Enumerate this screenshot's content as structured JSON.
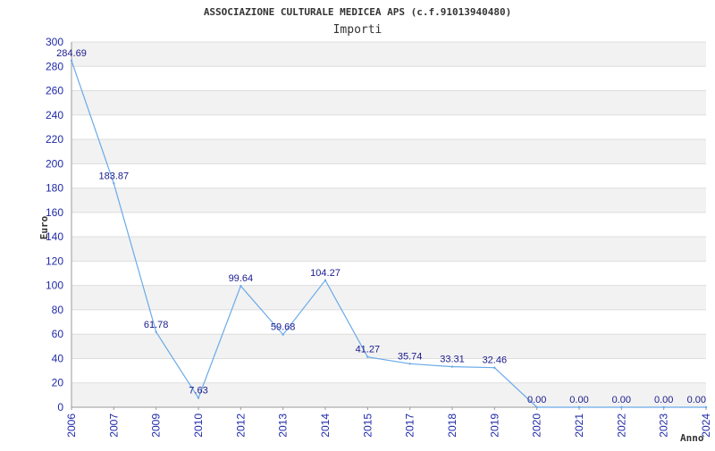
{
  "chart_data": {
    "type": "line",
    "title": "ASSOCIAZIONE CULTURALE MEDICEA APS (c.f.91013940480)",
    "subtitle": "Importi",
    "xlabel": "Anno",
    "ylabel": "Euro",
    "ylim": [
      0,
      300
    ],
    "y_ticks": [
      "0",
      "20",
      "40",
      "60",
      "80",
      "100",
      "120",
      "140",
      "160",
      "180",
      "200",
      "220",
      "240",
      "260",
      "280",
      "300"
    ],
    "categories": [
      "2006",
      "2007",
      "2009",
      "2010",
      "2012",
      "2013",
      "2014",
      "2015",
      "2017",
      "2018",
      "2019",
      "2020",
      "2021",
      "2022",
      "2023",
      "2024"
    ],
    "values": [
      284.69,
      183.87,
      61.78,
      7.63,
      99.64,
      59.68,
      104.27,
      41.27,
      35.74,
      33.31,
      32.46,
      0.0,
      0.0,
      0.0,
      0.0,
      0.0
    ],
    "value_labels": [
      "284.69",
      "183.87",
      "61.78",
      "7.63",
      "99.64",
      "59.68",
      "104.27",
      "41.27",
      "35.74",
      "33.31",
      "32.46",
      "0.00",
      "0.00",
      "0.00",
      "0.00",
      "0.00"
    ],
    "grid": true,
    "colors": {
      "line": "#6aaae8",
      "band": "#f2f2f2",
      "tick": "#1f2aa8",
      "label": "#1a1a8c"
    }
  }
}
